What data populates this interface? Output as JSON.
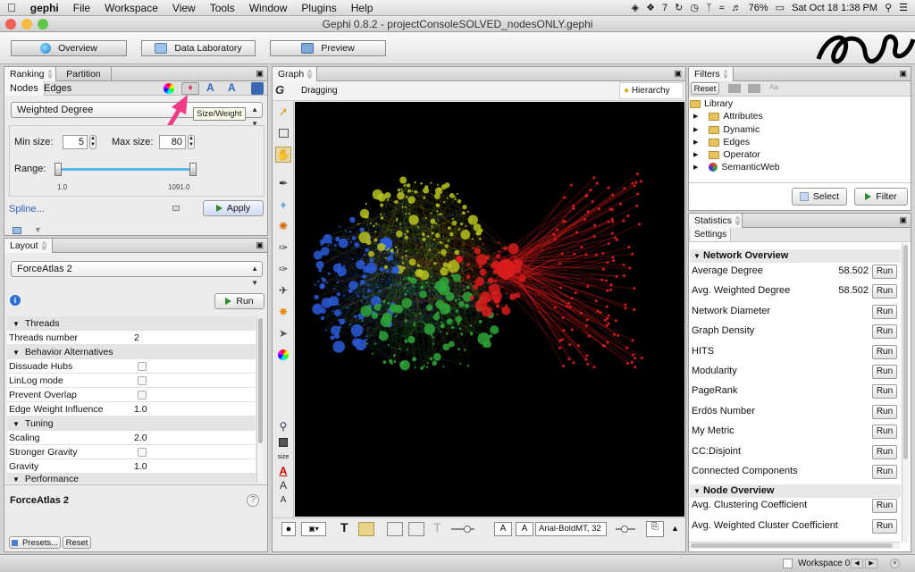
{
  "menubar": {
    "app": "gephi",
    "items": [
      "File",
      "Workspace",
      "View",
      "Tools",
      "Window",
      "Plugins",
      "Help"
    ],
    "status_number": "7",
    "battery": "76%",
    "clock": "Sat Oct 18  1:38 PM"
  },
  "window": {
    "title": "Gephi 0.8.2 - projectConsoleSOLVED_nodesONLY.gephi"
  },
  "toolbar": {
    "overview": "Overview",
    "data_lab": "Data Laboratory",
    "preview": "Preview"
  },
  "ranking": {
    "tab_ranking": "Ranking",
    "tab_partition": "Partition",
    "sub_nodes": "Nodes",
    "sub_edges": "Edges",
    "attribute": "Weighted Degree",
    "tooltip": "Size/Weight",
    "min_size_label": "Min size:",
    "min_size": "5",
    "max_size_label": "Max size:",
    "max_size": "80",
    "range_label": "Range:",
    "range_min": "1.0",
    "range_max": "1091.0",
    "spline": "Spline...",
    "apply": "Apply"
  },
  "layout": {
    "tab": "Layout",
    "algorithm": "ForceAtlas 2",
    "run": "Run",
    "rows": [
      {
        "type": "cat",
        "label": "Threads"
      },
      {
        "type": "val",
        "label": "Threads number",
        "value": "2"
      },
      {
        "type": "cat",
        "label": "Behavior Alternatives"
      },
      {
        "type": "chk",
        "label": "Dissuade Hubs"
      },
      {
        "type": "chk",
        "label": "LinLog mode"
      },
      {
        "type": "chk",
        "label": "Prevent Overlap"
      },
      {
        "type": "val",
        "label": "Edge Weight Influence",
        "value": "1.0"
      },
      {
        "type": "cat",
        "label": "Tuning"
      },
      {
        "type": "val",
        "label": "Scaling",
        "value": "2.0"
      },
      {
        "type": "chk",
        "label": "Stronger Gravity"
      },
      {
        "type": "val",
        "label": "Gravity",
        "value": "1.0"
      },
      {
        "type": "cat",
        "label": "Performance"
      }
    ],
    "footer_title": "ForceAtlas 2",
    "help": "?",
    "presets": "Presets...",
    "reset": "Reset"
  },
  "graph": {
    "tab": "Graph",
    "mode": "Dragging",
    "hierarchy": "Hierarchy",
    "size_tool": "size",
    "font": "Arial-BoldMT, 32",
    "font_a1": "A",
    "font_a2": "A",
    "text_tool": "T"
  },
  "filters": {
    "tab": "Filters",
    "reset": "Reset",
    "library": "Library",
    "items": [
      "Attributes",
      "Dynamic",
      "Edges",
      "Operator",
      "SemanticWeb"
    ],
    "select": "Select",
    "filter": "Filter"
  },
  "statistics": {
    "tab": "Statistics",
    "settings": "Settings",
    "network_header": "Network Overview",
    "network": [
      {
        "label": "Average Degree",
        "value": "58.502",
        "run": "Run"
      },
      {
        "label": "Avg. Weighted Degree",
        "value": "58.502",
        "run": "Run"
      },
      {
        "label": "Network Diameter",
        "value": "",
        "run": "Run"
      },
      {
        "label": "Graph Density",
        "value": "",
        "run": "Run"
      },
      {
        "label": "HITS",
        "value": "",
        "run": "Run"
      },
      {
        "label": "Modularity",
        "value": "",
        "run": "Run"
      },
      {
        "label": "PageRank",
        "value": "",
        "run": "Run"
      },
      {
        "label": "Erdös Number",
        "value": "",
        "run": "Run"
      },
      {
        "label": "My Metric",
        "value": "",
        "run": "Run"
      },
      {
        "label": "CC:Disjoint",
        "value": "",
        "run": "Run"
      },
      {
        "label": "Connected Components",
        "value": "",
        "run": "Run"
      }
    ],
    "node_header": "Node Overview",
    "node": [
      {
        "label": "Avg. Clustering Coefficient",
        "value": "",
        "run": "Run"
      },
      {
        "label": "Avg. Weighted Cluster Coefficient",
        "value": "",
        "run": "Run"
      }
    ]
  },
  "statusbar": {
    "workspace": "Workspace 0"
  },
  "colors": {
    "accent_arrow": "#ee3d86",
    "graph_bg": "#000000",
    "cluster_blue": "#2a5ad8",
    "cluster_yellow": "#b7c21e",
    "cluster_green": "#2fa53a",
    "cluster_red": "#d81c1c"
  }
}
